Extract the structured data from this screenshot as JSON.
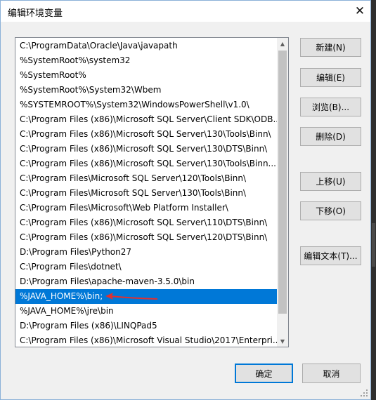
{
  "window": {
    "title": "编辑环境变量",
    "close": "✕"
  },
  "list": {
    "items": [
      "C:\\ProgramData\\Oracle\\Java\\javapath",
      "%SystemRoot%\\system32",
      "%SystemRoot%",
      "%SystemRoot%\\System32\\Wbem",
      "%SYSTEMROOT%\\System32\\WindowsPowerShell\\v1.0\\",
      "C:\\Program Files (x86)\\Microsoft SQL Server\\Client SDK\\ODB...",
      "C:\\Program Files (x86)\\Microsoft SQL Server\\130\\Tools\\Binn\\",
      "C:\\Program Files (x86)\\Microsoft SQL Server\\130\\DTS\\Binn\\",
      "C:\\Program Files (x86)\\Microsoft SQL Server\\130\\Tools\\Binn...",
      "C:\\Program Files\\Microsoft SQL Server\\120\\Tools\\Binn\\",
      "C:\\Program Files\\Microsoft SQL Server\\130\\Tools\\Binn\\",
      "C:\\Program Files\\Microsoft\\Web Platform Installer\\",
      "C:\\Program Files (x86)\\Microsoft SQL Server\\110\\DTS\\Binn\\",
      "C:\\Program Files (x86)\\Microsoft SQL Server\\120\\DTS\\Binn\\",
      "D:\\Program Files\\Python27",
      "C:\\Program Files\\dotnet\\",
      "D:\\Program Files\\apache-maven-3.5.0\\bin",
      "%JAVA_HOME%\\bin;",
      "%JAVA_HOME%\\jre\\bin",
      "D:\\Program Files (x86)\\LINQPad5",
      "C:\\Program Files (x86)\\Microsoft Visual Studio\\2017\\Enterpri..."
    ],
    "selected_index": 17
  },
  "buttons": {
    "new": "新建(N)",
    "edit": "编辑(E)",
    "browse": "浏览(B)...",
    "delete": "删除(D)",
    "move_up": "上移(U)",
    "move_down": "下移(O)",
    "edit_text": "编辑文本(T)...",
    "ok": "确定",
    "cancel": "取消"
  },
  "colors": {
    "selection": "#0078d7",
    "annotation_arrow": "#e03030"
  }
}
